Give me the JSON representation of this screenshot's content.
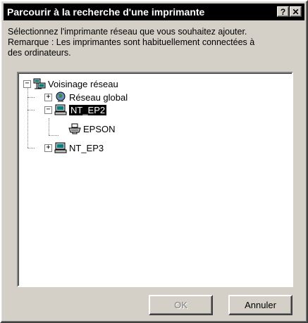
{
  "window": {
    "title": "Parcourir à la recherche d'une imprimante",
    "help_glyph": "?",
    "close_glyph": "✕"
  },
  "description": {
    "line1": "Sélectionnez l'imprimante réseau que vous souhaitez ajouter.",
    "line2": "Remarque : Les imprimantes sont habituellement connectées à",
    "line3": "des ordinateurs."
  },
  "tree": {
    "root": {
      "label": "Voisinage réseau",
      "toggle": "−",
      "icon": "network-neighborhood-icon"
    },
    "items": [
      {
        "label": "Réseau global",
        "toggle": "+",
        "icon": "globe-icon"
      },
      {
        "label": "NT_EP2",
        "toggle": "−",
        "icon": "computer-icon",
        "selected": true
      },
      {
        "label": "EPSON",
        "icon": "printer-icon"
      },
      {
        "label": "NT_EP3",
        "toggle": "+",
        "icon": "computer-icon"
      }
    ]
  },
  "buttons": {
    "ok_label": "OK",
    "cancel_label": "Annuler"
  }
}
